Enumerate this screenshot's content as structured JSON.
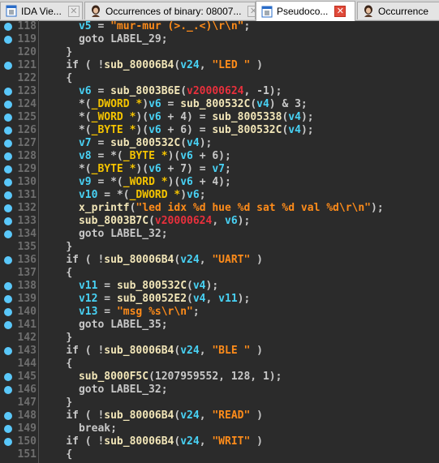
{
  "tabs": [
    {
      "label": "IDA Vie...",
      "icon": "ida-view-icon",
      "active": false
    },
    {
      "label": "Occurrences of binary: 08007...",
      "icon": "portrait-icon",
      "active": false
    },
    {
      "label": "Pseudoco...",
      "icon": "ida-view-icon",
      "active": true
    },
    {
      "label": "Occurrence",
      "icon": "portrait-icon",
      "active": false
    }
  ],
  "colors": {
    "variable": "#48d2f5",
    "function": "#f2e6b8",
    "type": "#f5c400",
    "string": "#ff8c1a",
    "constant": "#e8303c",
    "default": "#c8c8c8",
    "background": "#2b2b2b",
    "breakpoint": "#5ac8fa"
  },
  "code": [
    {
      "n": "118",
      "dot": true,
      "ind": 6,
      "tok": [
        [
          "v",
          "v5"
        ],
        [
          "k",
          " = "
        ],
        [
          "s",
          "\"mur-mur (>._.<)\\r\\n\""
        ],
        [
          "k",
          ";"
        ]
      ]
    },
    {
      "n": "119",
      "dot": true,
      "ind": 6,
      "tok": [
        [
          "k",
          "goto LABEL_29;"
        ]
      ]
    },
    {
      "n": "120",
      "dot": false,
      "ind": 4,
      "tok": [
        [
          "k",
          "}"
        ]
      ]
    },
    {
      "n": "121",
      "dot": true,
      "ind": 4,
      "tok": [
        [
          "k",
          "if ( !"
        ],
        [
          "f",
          "sub_80006B4"
        ],
        [
          "k",
          "("
        ],
        [
          "v",
          "v24"
        ],
        [
          "k",
          ", "
        ],
        [
          "s",
          "\"LED \""
        ],
        [
          "k",
          " )"
        ]
      ]
    },
    {
      "n": "122",
      "dot": false,
      "ind": 4,
      "tok": [
        [
          "k",
          "{"
        ]
      ]
    },
    {
      "n": "123",
      "dot": true,
      "ind": 6,
      "tok": [
        [
          "v",
          "v6"
        ],
        [
          "k",
          " = "
        ],
        [
          "f",
          "sub_8003B6E"
        ],
        [
          "k",
          "("
        ],
        [
          "r",
          "v20000624"
        ],
        [
          "k",
          ", -1);"
        ]
      ]
    },
    {
      "n": "124",
      "dot": true,
      "ind": 6,
      "tok": [
        [
          "k",
          "*("
        ],
        [
          "t",
          "_DWORD *"
        ],
        [
          "k",
          ")"
        ],
        [
          "v",
          "v6"
        ],
        [
          "k",
          " = "
        ],
        [
          "f",
          "sub_800532C"
        ],
        [
          "k",
          "("
        ],
        [
          "v",
          "v4"
        ],
        [
          "k",
          ") & 3;"
        ]
      ]
    },
    {
      "n": "125",
      "dot": true,
      "ind": 6,
      "tok": [
        [
          "k",
          "*("
        ],
        [
          "t",
          "_WORD *"
        ],
        [
          "k",
          ")("
        ],
        [
          "v",
          "v6"
        ],
        [
          "k",
          " + 4) = "
        ],
        [
          "f",
          "sub_8005338"
        ],
        [
          "k",
          "("
        ],
        [
          "v",
          "v4"
        ],
        [
          "k",
          ");"
        ]
      ]
    },
    {
      "n": "126",
      "dot": true,
      "ind": 6,
      "tok": [
        [
          "k",
          "*("
        ],
        [
          "t",
          "_BYTE *"
        ],
        [
          "k",
          ")("
        ],
        [
          "v",
          "v6"
        ],
        [
          "k",
          " + 6) = "
        ],
        [
          "f",
          "sub_800532C"
        ],
        [
          "k",
          "("
        ],
        [
          "v",
          "v4"
        ],
        [
          "k",
          ");"
        ]
      ]
    },
    {
      "n": "127",
      "dot": true,
      "ind": 6,
      "tok": [
        [
          "v",
          "v7"
        ],
        [
          "k",
          " = "
        ],
        [
          "f",
          "sub_800532C"
        ],
        [
          "k",
          "("
        ],
        [
          "v",
          "v4"
        ],
        [
          "k",
          ");"
        ]
      ]
    },
    {
      "n": "128",
      "dot": true,
      "ind": 6,
      "tok": [
        [
          "v",
          "v8"
        ],
        [
          "k",
          " = *("
        ],
        [
          "t",
          "_BYTE *"
        ],
        [
          "k",
          ")("
        ],
        [
          "v",
          "v6"
        ],
        [
          "k",
          " + 6);"
        ]
      ]
    },
    {
      "n": "129",
      "dot": true,
      "ind": 6,
      "tok": [
        [
          "k",
          "*("
        ],
        [
          "t",
          "_BYTE *"
        ],
        [
          "k",
          ")("
        ],
        [
          "v",
          "v6"
        ],
        [
          "k",
          " + 7) = "
        ],
        [
          "v",
          "v7"
        ],
        [
          "k",
          ";"
        ]
      ]
    },
    {
      "n": "130",
      "dot": true,
      "ind": 6,
      "tok": [
        [
          "v",
          "v9"
        ],
        [
          "k",
          " = *("
        ],
        [
          "t",
          "_WORD *"
        ],
        [
          "k",
          ")("
        ],
        [
          "v",
          "v6"
        ],
        [
          "k",
          " + 4);"
        ]
      ]
    },
    {
      "n": "131",
      "dot": true,
      "ind": 6,
      "tok": [
        [
          "v",
          "v10"
        ],
        [
          "k",
          " = *("
        ],
        [
          "t",
          "_DWORD *"
        ],
        [
          "k",
          ")"
        ],
        [
          "v",
          "v6"
        ],
        [
          "k",
          ";"
        ]
      ]
    },
    {
      "n": "132",
      "dot": true,
      "ind": 6,
      "tok": [
        [
          "f",
          "x_printf"
        ],
        [
          "k",
          "("
        ],
        [
          "s",
          "\"led idx %d hue %d sat %d val %d\\r\\n\""
        ],
        [
          "k",
          ");"
        ]
      ]
    },
    {
      "n": "133",
      "dot": true,
      "ind": 6,
      "tok": [
        [
          "f",
          "sub_8003B7C"
        ],
        [
          "k",
          "("
        ],
        [
          "r",
          "v20000624"
        ],
        [
          "k",
          ", "
        ],
        [
          "v",
          "v6"
        ],
        [
          "k",
          ");"
        ]
      ]
    },
    {
      "n": "134",
      "dot": true,
      "ind": 6,
      "tok": [
        [
          "k",
          "goto LABEL_32;"
        ]
      ]
    },
    {
      "n": "135",
      "dot": false,
      "ind": 4,
      "tok": [
        [
          "k",
          "}"
        ]
      ]
    },
    {
      "n": "136",
      "dot": true,
      "ind": 4,
      "tok": [
        [
          "k",
          "if ( !"
        ],
        [
          "f",
          "sub_80006B4"
        ],
        [
          "k",
          "("
        ],
        [
          "v",
          "v24"
        ],
        [
          "k",
          ", "
        ],
        [
          "s",
          "\"UART\""
        ],
        [
          "k",
          " )"
        ]
      ]
    },
    {
      "n": "137",
      "dot": false,
      "ind": 4,
      "tok": [
        [
          "k",
          "{"
        ]
      ]
    },
    {
      "n": "138",
      "dot": true,
      "ind": 6,
      "tok": [
        [
          "v",
          "v11"
        ],
        [
          "k",
          " = "
        ],
        [
          "f",
          "sub_800532C"
        ],
        [
          "k",
          "("
        ],
        [
          "v",
          "v4"
        ],
        [
          "k",
          ");"
        ]
      ]
    },
    {
      "n": "139",
      "dot": true,
      "ind": 6,
      "tok": [
        [
          "v",
          "v12"
        ],
        [
          "k",
          " = "
        ],
        [
          "f",
          "sub_80052E2"
        ],
        [
          "k",
          "("
        ],
        [
          "v",
          "v4"
        ],
        [
          "k",
          ", "
        ],
        [
          "v",
          "v11"
        ],
        [
          "k",
          ");"
        ]
      ]
    },
    {
      "n": "140",
      "dot": true,
      "ind": 6,
      "tok": [
        [
          "v",
          "v13"
        ],
        [
          "k",
          " = "
        ],
        [
          "s",
          "\"msg %s\\r\\n\""
        ],
        [
          "k",
          ";"
        ]
      ]
    },
    {
      "n": "141",
      "dot": true,
      "ind": 6,
      "tok": [
        [
          "k",
          "goto LABEL_35;"
        ]
      ]
    },
    {
      "n": "142",
      "dot": false,
      "ind": 4,
      "tok": [
        [
          "k",
          "}"
        ]
      ]
    },
    {
      "n": "143",
      "dot": true,
      "ind": 4,
      "tok": [
        [
          "k",
          "if ( !"
        ],
        [
          "f",
          "sub_80006B4"
        ],
        [
          "k",
          "("
        ],
        [
          "v",
          "v24"
        ],
        [
          "k",
          ", "
        ],
        [
          "s",
          "\"BLE \""
        ],
        [
          "k",
          " )"
        ]
      ]
    },
    {
      "n": "144",
      "dot": false,
      "ind": 4,
      "tok": [
        [
          "k",
          "{"
        ]
      ]
    },
    {
      "n": "145",
      "dot": true,
      "ind": 6,
      "tok": [
        [
          "f",
          "sub_8000F5C"
        ],
        [
          "k",
          "(1207959552, 128, 1);"
        ]
      ]
    },
    {
      "n": "146",
      "dot": true,
      "ind": 6,
      "tok": [
        [
          "k",
          "goto LABEL_32;"
        ]
      ]
    },
    {
      "n": "147",
      "dot": false,
      "ind": 4,
      "tok": [
        [
          "k",
          "}"
        ]
      ]
    },
    {
      "n": "148",
      "dot": true,
      "ind": 4,
      "tok": [
        [
          "k",
          "if ( !"
        ],
        [
          "f",
          "sub_80006B4"
        ],
        [
          "k",
          "("
        ],
        [
          "v",
          "v24"
        ],
        [
          "k",
          ", "
        ],
        [
          "s",
          "\"READ\""
        ],
        [
          "k",
          " )"
        ]
      ]
    },
    {
      "n": "149",
      "dot": true,
      "ind": 6,
      "tok": [
        [
          "k",
          "break;"
        ]
      ]
    },
    {
      "n": "150",
      "dot": true,
      "ind": 4,
      "tok": [
        [
          "k",
          "if ( !"
        ],
        [
          "f",
          "sub_80006B4"
        ],
        [
          "k",
          "("
        ],
        [
          "v",
          "v24"
        ],
        [
          "k",
          ", "
        ],
        [
          "s",
          "\"WRIT\""
        ],
        [
          "k",
          " )"
        ]
      ]
    },
    {
      "n": "151",
      "dot": false,
      "ind": 4,
      "tok": [
        [
          "k",
          "{"
        ]
      ]
    }
  ]
}
